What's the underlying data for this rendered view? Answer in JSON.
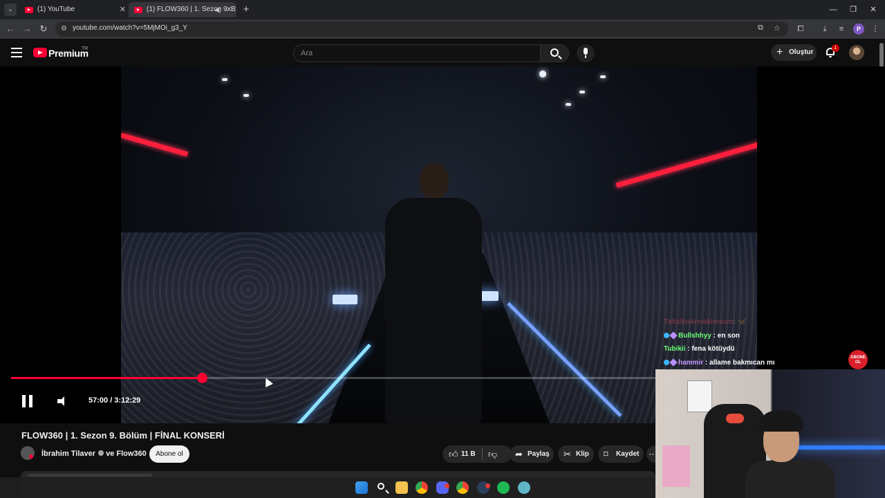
{
  "browser": {
    "tabs": [
      {
        "title": "(1) YouTube",
        "active": false
      },
      {
        "title": "(1) FLOW360 | 1. Sezon 9. B",
        "active": true
      }
    ],
    "url": "youtube.com/watch?v=5MjMOi_g3_Y"
  },
  "header": {
    "brand": "Premium",
    "region": "TR",
    "search_placeholder": "Ara",
    "create_label": "Oluştur",
    "notification_count": "1"
  },
  "player": {
    "current_time": "57:00",
    "duration": "3:12:29",
    "time_display": "57:00 / 3:12:29",
    "progress_fraction": 0.296,
    "chat": [
      {
        "name": "Bullshhyy",
        "text": ": en son",
        "color": "green",
        "badges": true
      },
      {
        "name": "Tubikii",
        "text": ": fena kötüydü",
        "color": "green",
        "badges": false
      },
      {
        "name": "hammir",
        "text": ": allame bakmıcan mı",
        "color": "purple",
        "badges": true
      }
    ],
    "overlay_badge": "ABONE OL"
  },
  "video": {
    "title": "FLOW360 | 1. Sezon 9. Bölüm | FİNAL KONSERİ",
    "channel": "İbrahim Tilaver",
    "channel_suffix": "ve Flow360",
    "subscribe_label": "Abone ol",
    "like_count": "11 B",
    "share_label": "Paylaş",
    "clip_label": "Klip",
    "save_label": "Kaydet"
  },
  "colors": {
    "accent": "#ff0033",
    "background": "#0f0f0f",
    "chat_green": "#6dff7a",
    "chat_purple": "#c899ff"
  },
  "taskbar": {
    "apps": [
      "windows-icon",
      "search-icon",
      "file-explorer-icon",
      "chrome-icon",
      "discord-icon",
      "chrome-icon",
      "steam-icon",
      "spotify-icon",
      "browser-icon"
    ]
  }
}
